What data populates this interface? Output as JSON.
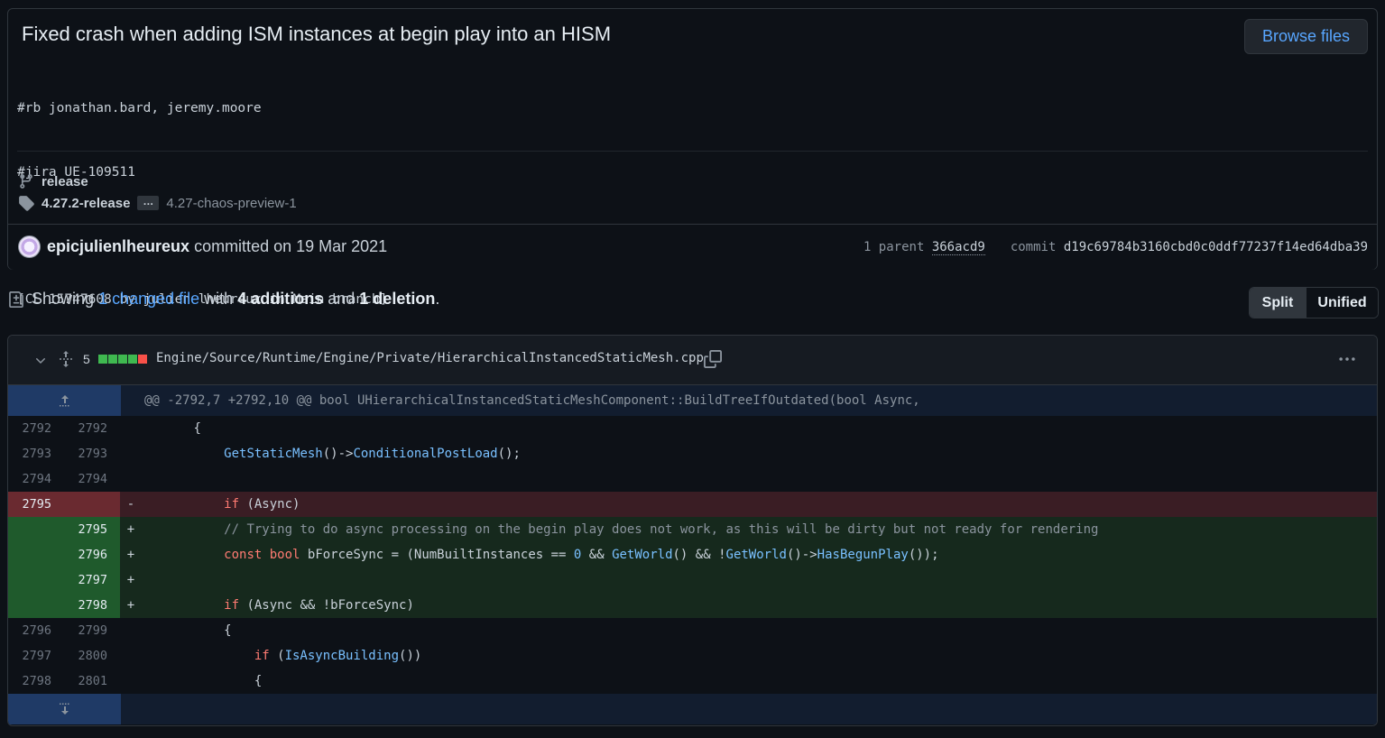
{
  "commit": {
    "title": "Fixed crash when adding ISM instances at begin play into an HISM",
    "browse_label": "Browse files",
    "desc_lines": [
      "#rb jonathan.bard, jeremy.moore",
      "#jira UE-109511",
      "",
      "[CL 15747608 by julien lheureux in Main branch]"
    ],
    "branch": "release",
    "tag": "4.27.2-release",
    "ellipsis": "…",
    "tag_more": "4.27-chaos-preview-1",
    "author": "epicjulienlheureux",
    "committed_text": "committed on 19 Mar 2021",
    "parent_label": "1 parent",
    "parent_sha": "366acd9",
    "commit_label": "commit",
    "commit_sha": "d19c69784b3160cbd0c0ddf77237f14ed64dba39"
  },
  "summary": {
    "showing": "Showing",
    "changed": "1 changed file",
    "with": "with",
    "additions": "4 additions",
    "and": "and",
    "deletions": "1 deletion",
    "period": ".",
    "split_label": "Split",
    "unified_label": "Unified"
  },
  "file": {
    "change_count": "5",
    "bars": [
      "add",
      "add",
      "add",
      "add",
      "del"
    ],
    "path": "Engine/Source/Runtime/Engine/Private/HierarchicalInstancedStaticMesh.cpp",
    "hunk_header": "@@ -2792,7 +2792,10 @@ bool UHierarchicalInstancedStaticMeshComponent::BuildTreeIfOutdated(bool Async,"
  },
  "colors": {
    "add_bar": "#3fb950",
    "del_bar": "#f85149",
    "link": "#58a6ff"
  },
  "diff_rows": [
    {
      "type": "ctx",
      "old": "2792",
      "new": "2792",
      "sign": "",
      "code": [
        [
          "",
          "\t\t{"
        ]
      ]
    },
    {
      "type": "ctx",
      "old": "2793",
      "new": "2793",
      "sign": "",
      "code": [
        [
          "",
          "\t\t\t"
        ],
        [
          "fn",
          "GetStaticMesh"
        ],
        [
          "",
          "()->"
        ],
        [
          "fn",
          "ConditionalPostLoad"
        ],
        [
          "",
          "();"
        ]
      ]
    },
    {
      "type": "ctx",
      "old": "2794",
      "new": "2794",
      "sign": "",
      "code": [
        [
          "",
          ""
        ]
      ]
    },
    {
      "type": "del",
      "old": "2795",
      "new": "",
      "sign": "-",
      "code": [
        [
          "",
          "\t\t\t"
        ],
        [
          "kw",
          "if"
        ],
        [
          "",
          " (Async)"
        ]
      ]
    },
    {
      "type": "add",
      "old": "",
      "new": "2795",
      "sign": "+",
      "code": [
        [
          "",
          "\t\t\t"
        ],
        [
          "cm",
          "// Trying to do async processing on the begin play does not work, as this will be dirty but not ready for rendering"
        ]
      ]
    },
    {
      "type": "add",
      "old": "",
      "new": "2796",
      "sign": "+",
      "code": [
        [
          "",
          "\t\t\t"
        ],
        [
          "kw",
          "const"
        ],
        [
          "",
          " "
        ],
        [
          "kw",
          "bool"
        ],
        [
          "",
          " bForceSync = (NumBuiltInstances == "
        ],
        [
          "num",
          "0"
        ],
        [
          "",
          " && "
        ],
        [
          "fn",
          "GetWorld"
        ],
        [
          "",
          "() && !"
        ],
        [
          "fn",
          "GetWorld"
        ],
        [
          "",
          "()->"
        ],
        [
          "fn",
          "HasBegunPlay"
        ],
        [
          "",
          "());"
        ]
      ]
    },
    {
      "type": "add",
      "old": "",
      "new": "2797",
      "sign": "+",
      "code": [
        [
          "",
          ""
        ]
      ]
    },
    {
      "type": "add",
      "old": "",
      "new": "2798",
      "sign": "+",
      "code": [
        [
          "",
          "\t\t\t"
        ],
        [
          "kw",
          "if"
        ],
        [
          "",
          " (Async && !bForceSync)"
        ]
      ]
    },
    {
      "type": "ctx",
      "old": "2796",
      "new": "2799",
      "sign": "",
      "code": [
        [
          "",
          "\t\t\t{"
        ]
      ]
    },
    {
      "type": "ctx",
      "old": "2797",
      "new": "2800",
      "sign": "",
      "code": [
        [
          "",
          "\t\t\t\t"
        ],
        [
          "kw",
          "if"
        ],
        [
          "",
          " ("
        ],
        [
          "fn",
          "IsAsyncBuilding"
        ],
        [
          "",
          "())"
        ]
      ]
    },
    {
      "type": "ctx",
      "old": "2798",
      "new": "2801",
      "sign": "",
      "code": [
        [
          "",
          "\t\t\t\t{"
        ]
      ]
    }
  ]
}
